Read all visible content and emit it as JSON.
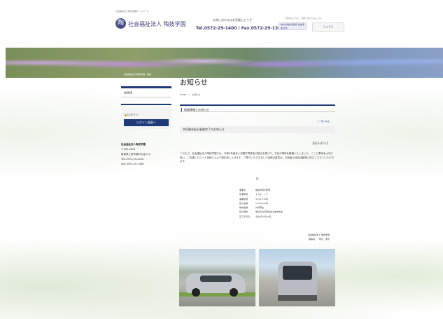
{
  "header": {
    "tagline": "社会福祉法人陶技学園ホームページ",
    "logo_mark": "陶",
    "logo_text": "社会福祉法人 陶技学園",
    "contact_lead": "お問い合わせはお気軽にどうぞ",
    "tel": "Tel.0572-29-1400 / Fax.0572-29-1388",
    "top_links": "ご意見はこちら　お問い合わせはこちら",
    "badge1": "岐阜県福祉事業所 推進事業 認定",
    "badge2": "しょうぶ"
  },
  "hero": {
    "breadcrumb": "社会福祉法人陶技学園　施設"
  },
  "sidebar": {
    "home": "HOME",
    "login_label": "ログイン",
    "login_button": "ログイン画面へ",
    "info": [
      "社会福祉法人陶技学園",
      "〒509-0000",
      "岐阜県土岐市泉町大富 2-2",
      "TEL.0572-29-2020",
      "FAX.0572-29-1388"
    ]
  },
  "main": {
    "page_title": "お知らせ",
    "breadcrumb": "HOME　>　お知らせ",
    "section_heading": "新着情報とお知らせ",
    "back_link": "＜一覧へ戻る",
    "news_title": "共同募金配分事業完了のお知らせ",
    "news_date": "2023-05-15",
    "body": "このたび、社会福祉法人陶技学園では、令和4年度赤い羽根共同募金の配分を受けて、下記の車両を整備いたしました。ここに車両を大切に使い、ご支援くださった皆様に心より御礼申し上げます。ご寄付いただきました皆様の善意は、利用者の送迎活動等に役立てさせていただきます。",
    "ki": "記",
    "spec": [
      {
        "k": "事業名",
        "v": "福祉車両の整備"
      },
      {
        "k": "整備車両",
        "v": "トヨタ　ノア"
      },
      {
        "k": "事業総額",
        "v": "3,531,570円"
      },
      {
        "k": "配分金額",
        "v": "1,570,000円"
      },
      {
        "k": "助成金額",
        "v": "共同募金"
      },
      {
        "k": "配分団体",
        "v": "岐阜県共同募金会土岐市支会"
      },
      {
        "k": "完了年月日",
        "v": "令和5年4月30日"
      }
    ],
    "signer": [
      "社会福祉法人 陶技学園",
      "理事長　　林田　慶次"
    ]
  },
  "photos": [
    "welfare-van-side-photo",
    "welfare-van-rear-photo"
  ],
  "colors": {
    "navy": "#1f3a78",
    "accent": "#3c4078",
    "link": "#2a4aa0"
  }
}
